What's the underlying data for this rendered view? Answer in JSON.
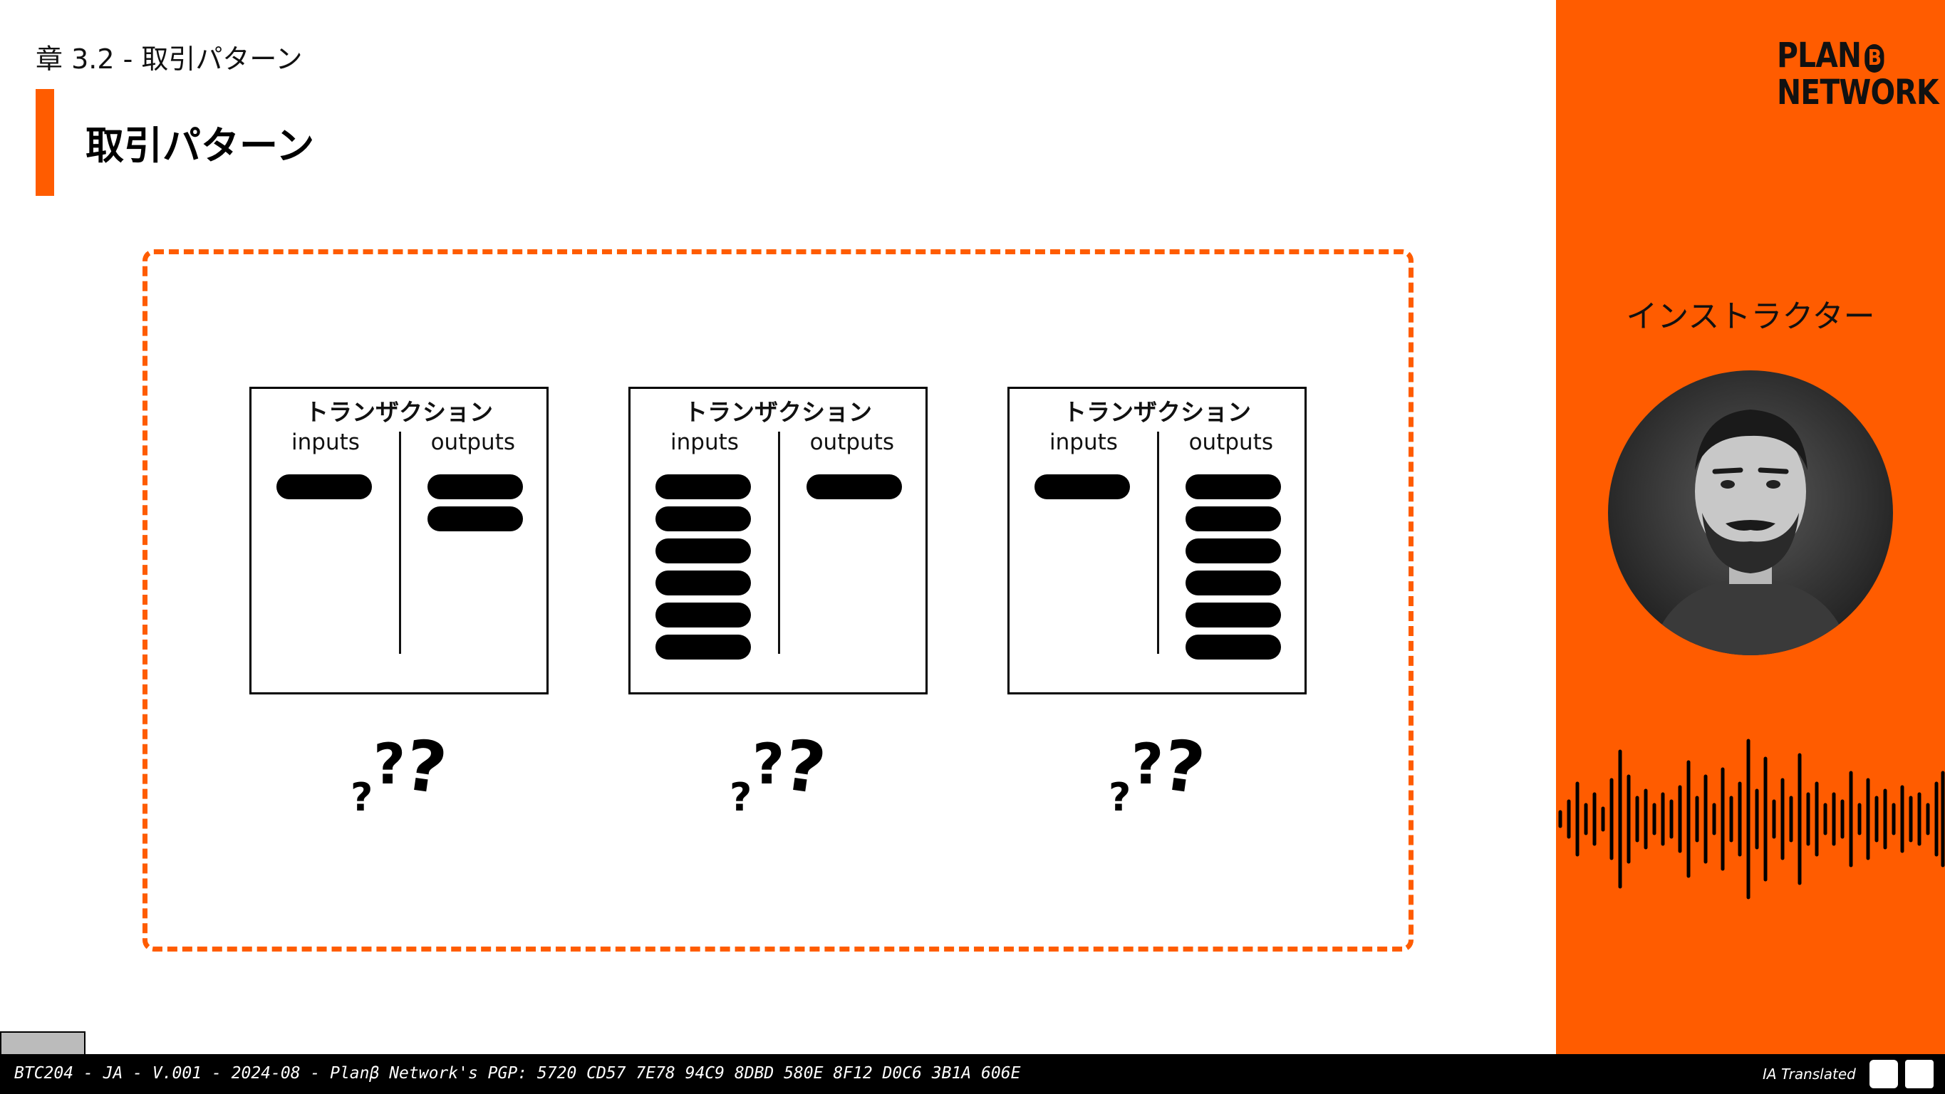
{
  "chapter": "章 3.2 - 取引パターン",
  "title": "取引パターン",
  "transactions": [
    {
      "title": "トランザクション",
      "inputs_label": "inputs",
      "outputs_label": "outputs",
      "inputs": 1,
      "outputs": 2
    },
    {
      "title": "トランザクション",
      "inputs_label": "inputs",
      "outputs_label": "outputs",
      "inputs": 6,
      "outputs": 1
    },
    {
      "title": "トランザクション",
      "inputs_label": "inputs",
      "outputs_label": "outputs",
      "inputs": 1,
      "outputs": 6
    }
  ],
  "sidebar": {
    "logo_line1": "PLAN",
    "logo_line2": "NETWORK",
    "logo_b": "B",
    "instructor_label": "インストラクター"
  },
  "footer": {
    "text": "BTC204 - JA - V.001 - 2024-08 - Planβ Network's PGP: 5720 CD57 7E78 94C9 8DBD 580E 8F12 D0C6 3B1A 606E",
    "ia_label": "IA Translated"
  },
  "colors": {
    "accent": "#ff5c00",
    "ink": "#000000"
  }
}
